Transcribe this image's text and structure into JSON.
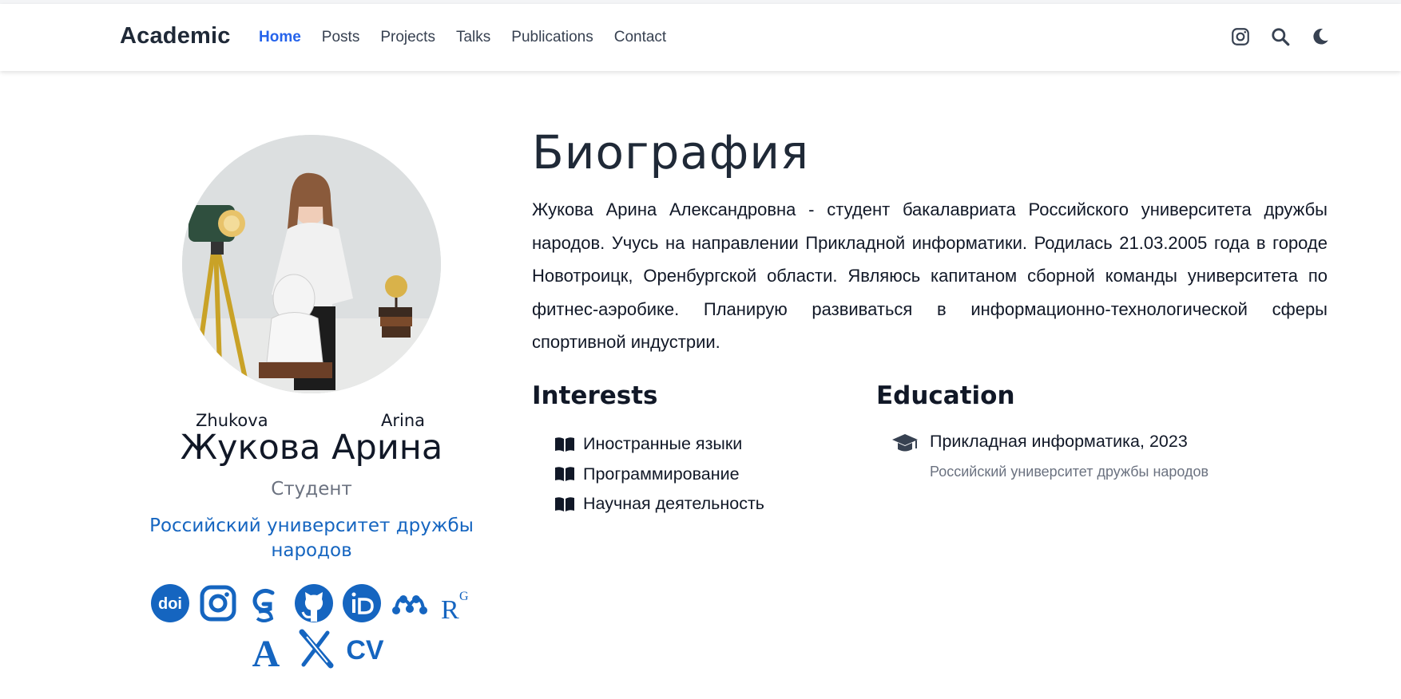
{
  "navbar": {
    "brand": "Academic",
    "links": [
      {
        "label": "Home",
        "active": true
      },
      {
        "label": "Posts"
      },
      {
        "label": "Projects"
      },
      {
        "label": "Talks"
      },
      {
        "label": "Publications"
      },
      {
        "label": "Contact"
      }
    ],
    "icons": [
      "instagram-icon",
      "search-icon",
      "moon-icon"
    ]
  },
  "profile": {
    "surname_latin": "Zhukova",
    "given_latin": "Arina",
    "display_name": "Жукова Арина",
    "role": "Студент",
    "organization": "Российский университет дружбы народов",
    "social_icons": [
      "doi-icon",
      "instagram-icon",
      "google-scholar-icon",
      "github-icon",
      "orcid-icon",
      "mendeley-icon",
      "researchgate-icon",
      "academia-icon",
      "arxiv-icon",
      "cv-icon"
    ],
    "social_labels": {
      "doi": "doi",
      "researchgate": "R",
      "researchgate_sup": "G",
      "academia": "A",
      "cv": "CV"
    }
  },
  "bio": {
    "title": "Биография",
    "text": "Жукова Арина Александровна - студент бакалавриата Российского университета дружбы народов. Учусь на направлении Прикладной информатики. Родилась 21.03.2005 года в городе Новотроицк, Оренбургской области. Являюсь капитаном сборной команды университета по фитнес-аэробике. Планирую развиваться в информационно-технологической сферы спортивной индустрии."
  },
  "interests": {
    "title": "Interests",
    "items": [
      "Иностранные языки",
      "Программирование",
      "Научная деятельность"
    ]
  },
  "education": {
    "title": "Education",
    "items": [
      {
        "course": "Прикладная информатика, 2023",
        "institution": "Российский университет дружбы народов"
      }
    ]
  },
  "colors": {
    "accent": "#2563eb",
    "social": "#1565c0",
    "text": "#111827",
    "muted": "#6b7280"
  }
}
